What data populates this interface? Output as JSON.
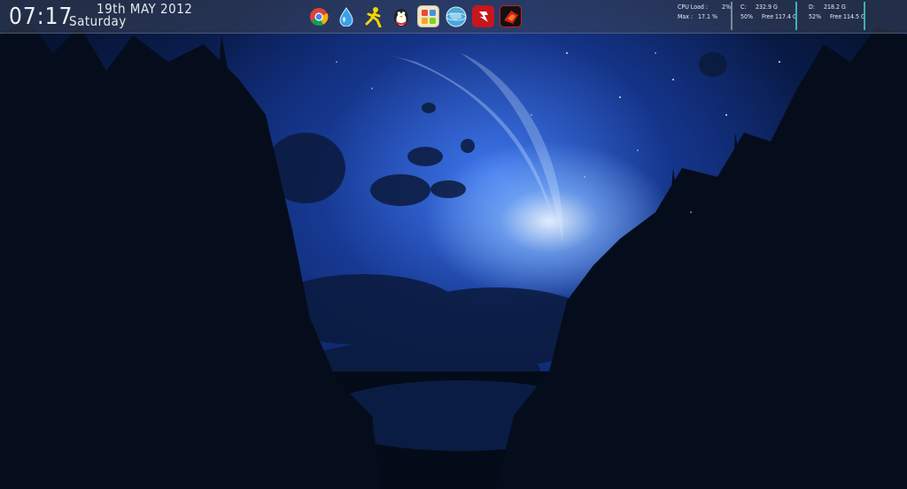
{
  "clock": {
    "time": "07:17",
    "date": "19th MAY 2012",
    "weekday": "Saturday"
  },
  "dock": {
    "icons": [
      {
        "name": "chrome-icon"
      },
      {
        "name": "water-drop-icon"
      },
      {
        "name": "aim-runner-icon"
      },
      {
        "name": "penguin-icon"
      },
      {
        "name": "photo-gallery-icon"
      },
      {
        "name": "globe-icon"
      },
      {
        "name": "red-app-icon"
      },
      {
        "name": "red-black-app-icon"
      }
    ]
  },
  "cpu": {
    "load_label": "CPU Load :",
    "load_value": "2%",
    "max_label": "Max :",
    "max_value": "17.1 %"
  },
  "drive_c": {
    "label": "C:",
    "total": "232.9 G",
    "used_pct": "50%",
    "free_label": "Free",
    "free_value": "117.4 G"
  },
  "drive_d": {
    "label": "D:",
    "total": "218.2 G",
    "used_pct": "52%",
    "free_label": "Free",
    "free_value": "114.5 G"
  },
  "colors": {
    "accent_teal": "#3fb0b6",
    "bar_bg": "#3c465a"
  }
}
